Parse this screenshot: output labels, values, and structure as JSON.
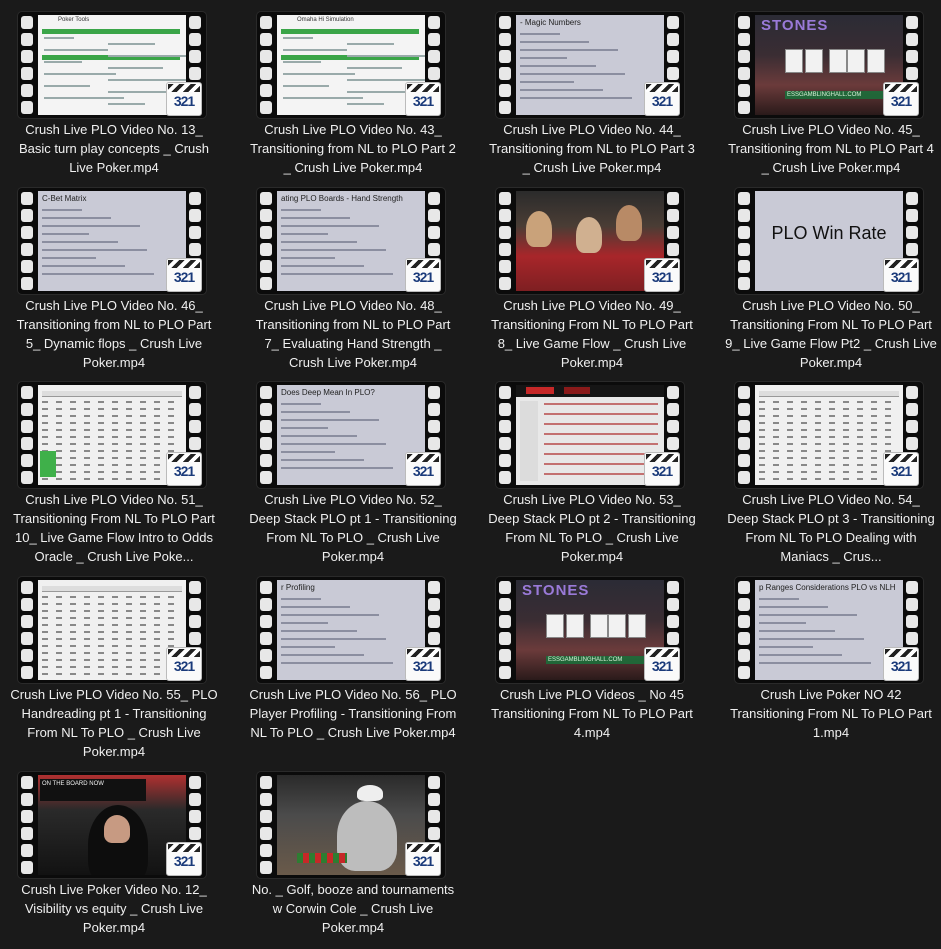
{
  "files": [
    {
      "caption": "Crush Live PLO Video No. 13_ Basic turn play concepts _ Crush Live Poker.mp4",
      "thumb": "sheet",
      "frame_title": "Poker Tools"
    },
    {
      "caption": "Crush Live PLO Video No. 43_ Transitioning from NL to PLO Part 2 _ Crush Live Poker.mp4",
      "thumb": "sheet",
      "frame_title": "Omaha Hi Simulation"
    },
    {
      "caption": "Crush Live PLO Video No. 44_ Transitioning from NL to PLO Part 3 _ Crush Live Poker.mp4",
      "thumb": "slide",
      "frame_title": "- Magic Numbers"
    },
    {
      "caption": "Crush Live PLO Video No. 45_ Transitioning from NL to PLO Part 4 _ Crush Live Poker.mp4",
      "thumb": "casino",
      "frame_title": "STONES"
    },
    {
      "caption": "Crush Live PLO Video No. 46_ Transitioning from NL to PLO Part 5_ Dynamic flops _ Crush Live Poker.mp4",
      "thumb": "slide",
      "frame_title": "C-Bet Matrix"
    },
    {
      "caption": "Crush Live PLO Video No. 48_ Transitioning from NL to PLO Part 7_ Evaluating Hand Strength _ Crush Live Poker.mp4",
      "thumb": "slide",
      "frame_title": "ating PLO Boards - Hand Strength"
    },
    {
      "caption": "Crush Live PLO Video No. 49_ Transitioning From NL To PLO Part 8_ Live Game Flow _ Crush Live Poker.mp4",
      "thumb": "felt",
      "frame_title": ""
    },
    {
      "caption": "Crush Live PLO Video No. 50_ Transitioning From NL To PLO Part 9_ Live Game Flow Pt2 _ Crush Live Poker.mp4",
      "thumb": "big",
      "frame_title": "PLO Win Rate"
    },
    {
      "caption": "Crush Live PLO Video No. 51_ Transitioning From NL To PLO Part 10_ Live Game Flow Intro to Odds Oracle _ Crush Live Poke...",
      "thumb": "table",
      "frame_title": ""
    },
    {
      "caption": "Crush Live PLO Video No. 52_ Deep Stack PLO pt 1 - Transitioning From NL To PLO _ Crush Live Poker.mp4",
      "thumb": "slide",
      "frame_title": "Does Deep Mean In PLO?"
    },
    {
      "caption": "Crush Live PLO Video No. 53_ Deep Stack PLO pt 2 - Transitioning From NL To PLO _ Crush Live Poker.mp4",
      "thumb": "web",
      "frame_title": ""
    },
    {
      "caption": "Crush Live PLO Video No. 54_ Deep Stack PLO pt 3 - Transitioning From NL To PLO Dealing with Maniacs _ Crus...",
      "thumb": "table",
      "frame_title": ""
    },
    {
      "caption": "Crush Live PLO Video No. 55_ PLO Handreading pt 1 - Transitioning From NL To PLO _ Crush Live Poker.mp4",
      "thumb": "table",
      "frame_title": ""
    },
    {
      "caption": "Crush Live PLO Video No. 56_ PLO Player Profiling - Transitioning From NL To PLO _ Crush Live Poker.mp4",
      "thumb": "slide",
      "frame_title": "r Profiling"
    },
    {
      "caption": "Crush Live PLO Videos _ No 45 Transitioning From NL To PLO Part 4.mp4",
      "thumb": "casino",
      "frame_title": "STONES"
    },
    {
      "caption": "Crush Live Poker NO 42 Transitioning From NL To PLO Part 1.mp4",
      "thumb": "slide",
      "frame_title": "p Ranges Considerations PLO vs NLH"
    },
    {
      "caption": "Crush Live Poker Video No. 12_ Visibility vs equity _ Crush Live Poker.mp4",
      "thumb": "player",
      "frame_title": "ON THE BOARD NOW"
    },
    {
      "caption": "No. _ Golf, booze and tournaments w Corwin Cole _ Crush Live Poker.mp4",
      "thumb": "golf",
      "frame_title": ""
    }
  ],
  "badge_label": "321",
  "casino_banner": "ESSGAMBLINGHALL.COM",
  "colors": {
    "background": "#1a1a1a",
    "caption_text": "#f0f0f0",
    "badge_text": "#1a3a7a"
  }
}
